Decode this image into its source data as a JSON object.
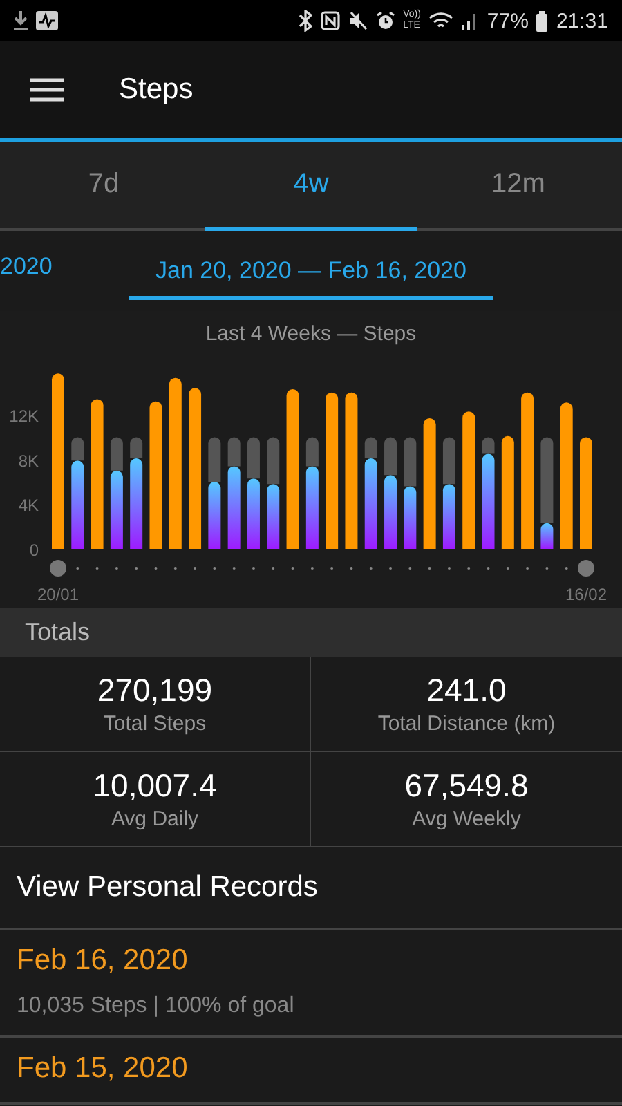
{
  "status_bar": {
    "battery": "77%",
    "time": "21:31",
    "volte_top": "Vo))",
    "volte_bottom": "LTE"
  },
  "app_bar": {
    "title": "Steps"
  },
  "tabs": [
    {
      "label": "7d",
      "selected": false
    },
    {
      "label": "4w",
      "selected": true
    },
    {
      "label": "12m",
      "selected": false
    }
  ],
  "range": {
    "previous": "2020",
    "current": "Jan 20, 2020 — Feb 16, 2020"
  },
  "chart": {
    "chart_data": {
      "type": "bar",
      "title": "Last 4 Weeks — Steps",
      "categories": [
        "20/01",
        null,
        null,
        null,
        null,
        null,
        null,
        null,
        null,
        null,
        null,
        null,
        null,
        null,
        null,
        null,
        null,
        null,
        null,
        null,
        null,
        null,
        null,
        null,
        null,
        null,
        null,
        "16/02"
      ],
      "ylim": [
        0,
        16000
      ],
      "yticks": [
        {
          "value": 0,
          "label": "0"
        },
        {
          "value": 4000,
          "label": "4K"
        },
        {
          "value": 8000,
          "label": "8K"
        },
        {
          "value": 12000,
          "label": "12K"
        }
      ],
      "stacked": true,
      "series": [
        {
          "color": "#9d1cff",
          "values": [
            null,
            7900,
            null,
            7000,
            8100,
            null,
            null,
            null,
            6000,
            7400,
            6300,
            5800,
            null,
            7400,
            null,
            null,
            8100,
            6600,
            5600,
            null,
            5800,
            null,
            8500,
            null,
            null,
            2300,
            null,
            null
          ]
        },
        {
          "color": "#555555",
          "values": [
            null,
            2100,
            null,
            3000,
            1900,
            null,
            null,
            null,
            4000,
            2600,
            3700,
            4200,
            null,
            2600,
            null,
            null,
            1900,
            3400,
            4400,
            null,
            4200,
            null,
            1500,
            null,
            null,
            7700,
            null,
            null
          ]
        },
        {
          "color": "#ff9800",
          "values": [
            15700,
            null,
            13400,
            null,
            null,
            13200,
            15300,
            14400,
            null,
            null,
            null,
            null,
            14300,
            null,
            14000,
            14000,
            null,
            null,
            null,
            11700,
            null,
            12300,
            null,
            10100,
            14000,
            null,
            13100,
            10000
          ]
        }
      ]
    }
  },
  "totals": {
    "header": "Totals",
    "stats": [
      {
        "value": "270,199",
        "label": "Total Steps"
      },
      {
        "value": "241.0",
        "label": "Total Distance (km)"
      },
      {
        "value": "10,007.4",
        "label": "Avg Daily"
      },
      {
        "value": "67,549.8",
        "label": "Avg Weekly"
      }
    ]
  },
  "personal_records": {
    "label": "View Personal Records"
  },
  "days": [
    {
      "date": "Feb 16, 2020",
      "summary": "10,035 Steps | 100% of goal"
    },
    {
      "date": "Feb 15, 2020"
    }
  ]
}
